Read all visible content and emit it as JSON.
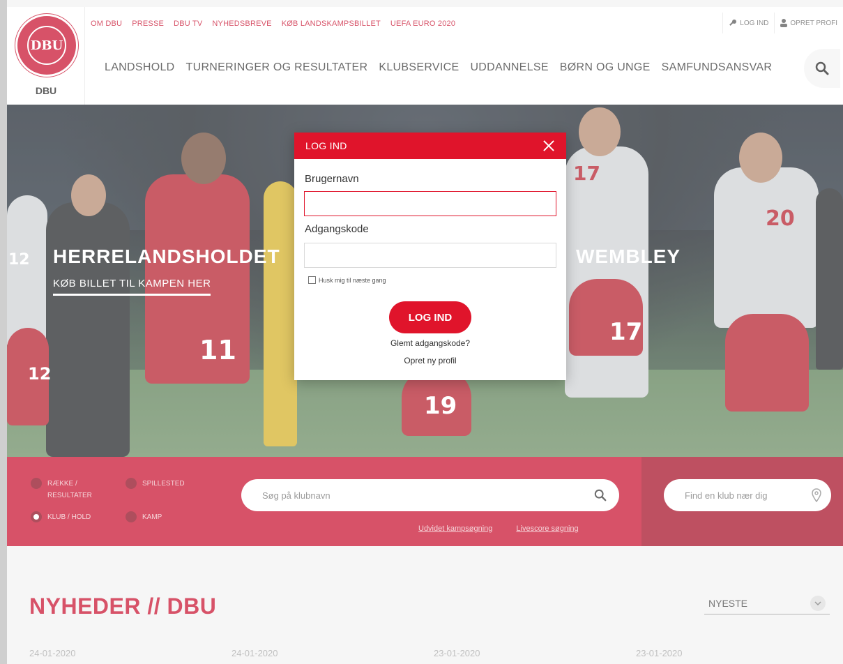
{
  "header": {
    "logo_text": "DBU",
    "logo_mark": "DBU",
    "top_nav": [
      "OM DBU",
      "PRESSE",
      "DBU TV",
      "NYHEDSBREVE",
      "KØB LANDSKAMPSBILLET",
      "UEFA EURO 2020"
    ],
    "login_label": "LOG IND",
    "create_profile_label": "OPRET PROFI",
    "main_nav": [
      "LANDSHOLD",
      "TURNERINGER OG RESULTATER",
      "KLUBSERVICE",
      "UDDANNELSE",
      "BØRN OG UNGE",
      "SAMFUNDSANSVAR"
    ]
  },
  "hero": {
    "title_left": "HERRELANDSHOLDET",
    "title_right": "WEMBLEY",
    "link": "KØB BILLET TIL KAMPEN HER",
    "jersey_numbers": [
      "12",
      "11",
      "17",
      "17",
      "20",
      "12",
      "19"
    ]
  },
  "search": {
    "radios": [
      {
        "label": "RÆKKE / RESULTATER",
        "checked": false
      },
      {
        "label": "SPILLESTED",
        "checked": false
      },
      {
        "label": "KLUB / HOLD",
        "checked": true
      },
      {
        "label": "KAMP",
        "checked": false
      }
    ],
    "club_placeholder": "Søg på klubnavn",
    "advanced_link": "Udvidet kampsøgning",
    "livescore_link": "Livescore søgning",
    "near_placeholder": "Find en klub nær dig"
  },
  "news": {
    "title": "NYHEDER // DBU",
    "sort_value": "NYESTE",
    "dates": [
      "24-01-2020",
      "24-01-2020",
      "23-01-2020",
      "23-01-2020"
    ]
  },
  "modal": {
    "title": "LOG IND",
    "username_label": "Brugernavn",
    "username_value": "",
    "password_label": "Adgangskode",
    "password_value": "",
    "remember_label": "Husk mig til næste gang",
    "submit_label": "LOG IND",
    "forgot_link": "Glemt adgangskode?",
    "create_link": "Opret ny profil"
  },
  "colors": {
    "brand_red": "#c8102e",
    "modal_red": "#e0142b"
  },
  "icons": [
    "search-icon",
    "key-icon",
    "user-icon",
    "close-icon",
    "location-pin-icon",
    "chevron-down-icon"
  ]
}
